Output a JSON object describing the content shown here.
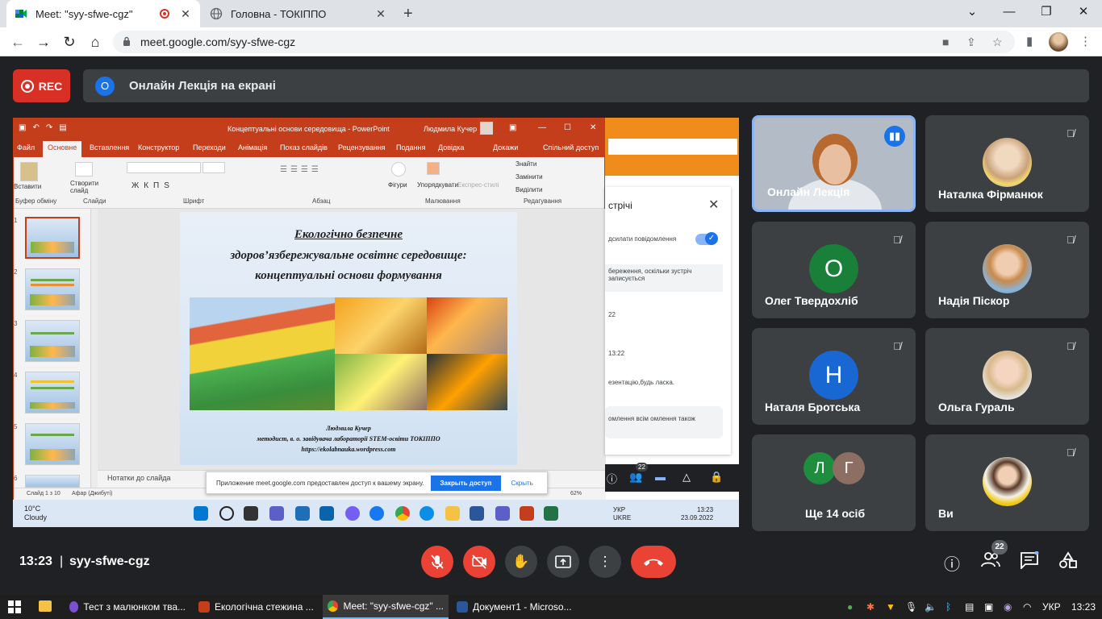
{
  "browser": {
    "tabs": [
      {
        "title": "Meet: \"syy-sfwe-cgz\"",
        "active": true
      },
      {
        "title": "Головна - ТОКІППО",
        "active": false
      }
    ],
    "url": "meet.google.com/syy-sfwe-cgz"
  },
  "meet": {
    "rec_label": "REC",
    "presenter_initial": "О",
    "presenting_label": "Онлайн Лекція на екрані",
    "time": "13:23",
    "separator": "|",
    "meeting_code": "syy-sfwe-cgz",
    "people_count": "22",
    "tiles": [
      {
        "name": "Онлайн Лекція",
        "speaking": true
      },
      {
        "name": "Наталка Фірманюк"
      },
      {
        "name": "Олег Твердохліб",
        "initial": "О",
        "color": "#188038"
      },
      {
        "name": "Надія Піскор"
      },
      {
        "name": "Наталя Бротська",
        "initial": "Н",
        "color": "#1967d2"
      },
      {
        "name": "Ольга Гураль"
      },
      {
        "name": "Ще 14 осіб",
        "initials": [
          "Л",
          "Г"
        ],
        "colors": [
          "#1e8e3e",
          "#8d6e63"
        ]
      },
      {
        "name": "Ви"
      }
    ]
  },
  "shared_screen": {
    "ppt_title": "Концептуальні основи середовища - PowerPoint",
    "ppt_user": "Людмила Кучер",
    "ppt_tabs": [
      "Файл",
      "Основне",
      "Вставлення",
      "Конструктор",
      "Переходи",
      "Анімація",
      "Показ слайдів",
      "Рецензування",
      "Подання",
      "Довідка",
      "Докажи",
      "Спільний доступ"
    ],
    "ribbon": {
      "paste": "Вставити",
      "new_slide": "Створити слайд",
      "shapes": "Фігури",
      "arrange": "Упорядкувати",
      "quick_styles": "Експрес-стилі",
      "find": "Знайти",
      "replace": "Замінити",
      "select": "Виділити",
      "groups": [
        "Буфер обміну",
        "Слайди",
        "Шрифт",
        "Абзац",
        "Малювання",
        "Редагування"
      ]
    },
    "slide_numbers": [
      "1",
      "2",
      "3",
      "4",
      "5",
      "6"
    ],
    "slide": {
      "line1": "Екологічно безпечне",
      "line2": "здоров’язбережувальне освітнє середовище:",
      "line3": "концептуальні основи формування",
      "author": "Людмила Кучер",
      "position": "методист, в. о. завідувача лабораторії STEM-освіти ТОКІППО",
      "site": "https://ekolabnauka.wordpress.com"
    },
    "notes_label": "Нотатки до слайда",
    "status_slide": "Слайд 1 з 10",
    "status_lang": "Афар (Джибуті)",
    "zoom": "62%",
    "share_msg": "Приложение meet.google.com предоставлен доступ к вашему экрану.",
    "stop_share": "Закрыть доступ",
    "hide": "Скрыть",
    "chat": {
      "title": "стрічі",
      "toggle_label": "дсилати повідомлення",
      "note": "береження, оскільки зустріч записується",
      "time1": "22",
      "time2": "13:22",
      "msg": "езентацію,будь ласка.",
      "input": "омлення всім омлення також"
    },
    "mini_badge": "22",
    "weather_temp": "10°C",
    "weather_desc": "Cloudy",
    "lang": "УКР",
    "lang2": "UKRE",
    "time": "13:23",
    "date": "23.09.2022"
  },
  "taskbar": {
    "apps": [
      {
        "label": "Тест з малюнком тва...",
        "color": "#7b4fd1"
      },
      {
        "label": "Екологічна стежина ...",
        "color": "#c43e1c"
      },
      {
        "label": "Meet: \"syy-sfwe-cgz\" ...",
        "color": "#4285f4",
        "active": true
      },
      {
        "label": "Документ1 - Microso...",
        "color": "#2b579a"
      }
    ],
    "lang": "УКР",
    "time": "13:23"
  }
}
